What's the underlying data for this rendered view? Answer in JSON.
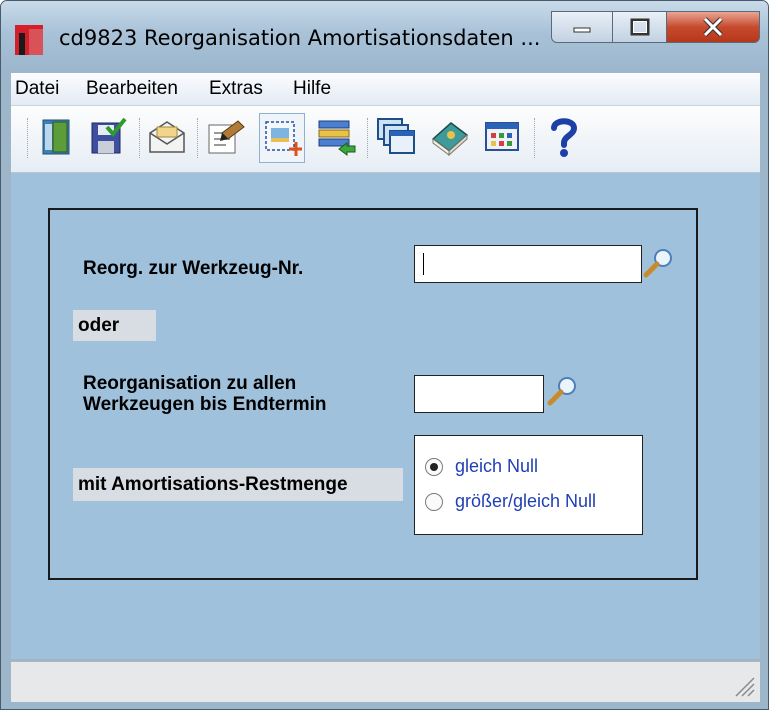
{
  "window": {
    "title": "cd9823 Reorganisation Amortisationsdaten ..."
  },
  "menu": [
    {
      "label": "Datei"
    },
    {
      "label": "Bearbeiten"
    },
    {
      "label": "Extras"
    },
    {
      "label": "Hilfe"
    }
  ],
  "toolbar": [
    {
      "icon": "exit-door-icon"
    },
    {
      "icon": "save-icon"
    },
    {
      "icon": "mail-icon"
    },
    {
      "icon": "edit-document-icon"
    },
    {
      "icon": "new-record-icon"
    },
    {
      "icon": "list-transfer-icon"
    },
    {
      "icon": "windows-icon"
    },
    {
      "icon": "book-icon"
    },
    {
      "icon": "table-icon"
    },
    {
      "icon": "help-icon"
    }
  ],
  "form": {
    "werkzeug_label": "Reorg. zur Werkzeug-Nr.",
    "werkzeug_value": "",
    "oder_label": "oder",
    "endtermin_label_line1": "Reorganisation zu allen",
    "endtermin_label_line2": "Werkzeugen bis Endtermin",
    "endtermin_value": "",
    "restmenge_label": "mit Amortisations-Restmenge",
    "radio_options": [
      {
        "label": "gleich Null",
        "selected": true
      },
      {
        "label": "größer/gleich Null",
        "selected": false
      }
    ]
  },
  "colors": {
    "client_bg": "#9fc1dc",
    "radio_text": "#1f3fb5",
    "close_button": "#c64b2d"
  }
}
